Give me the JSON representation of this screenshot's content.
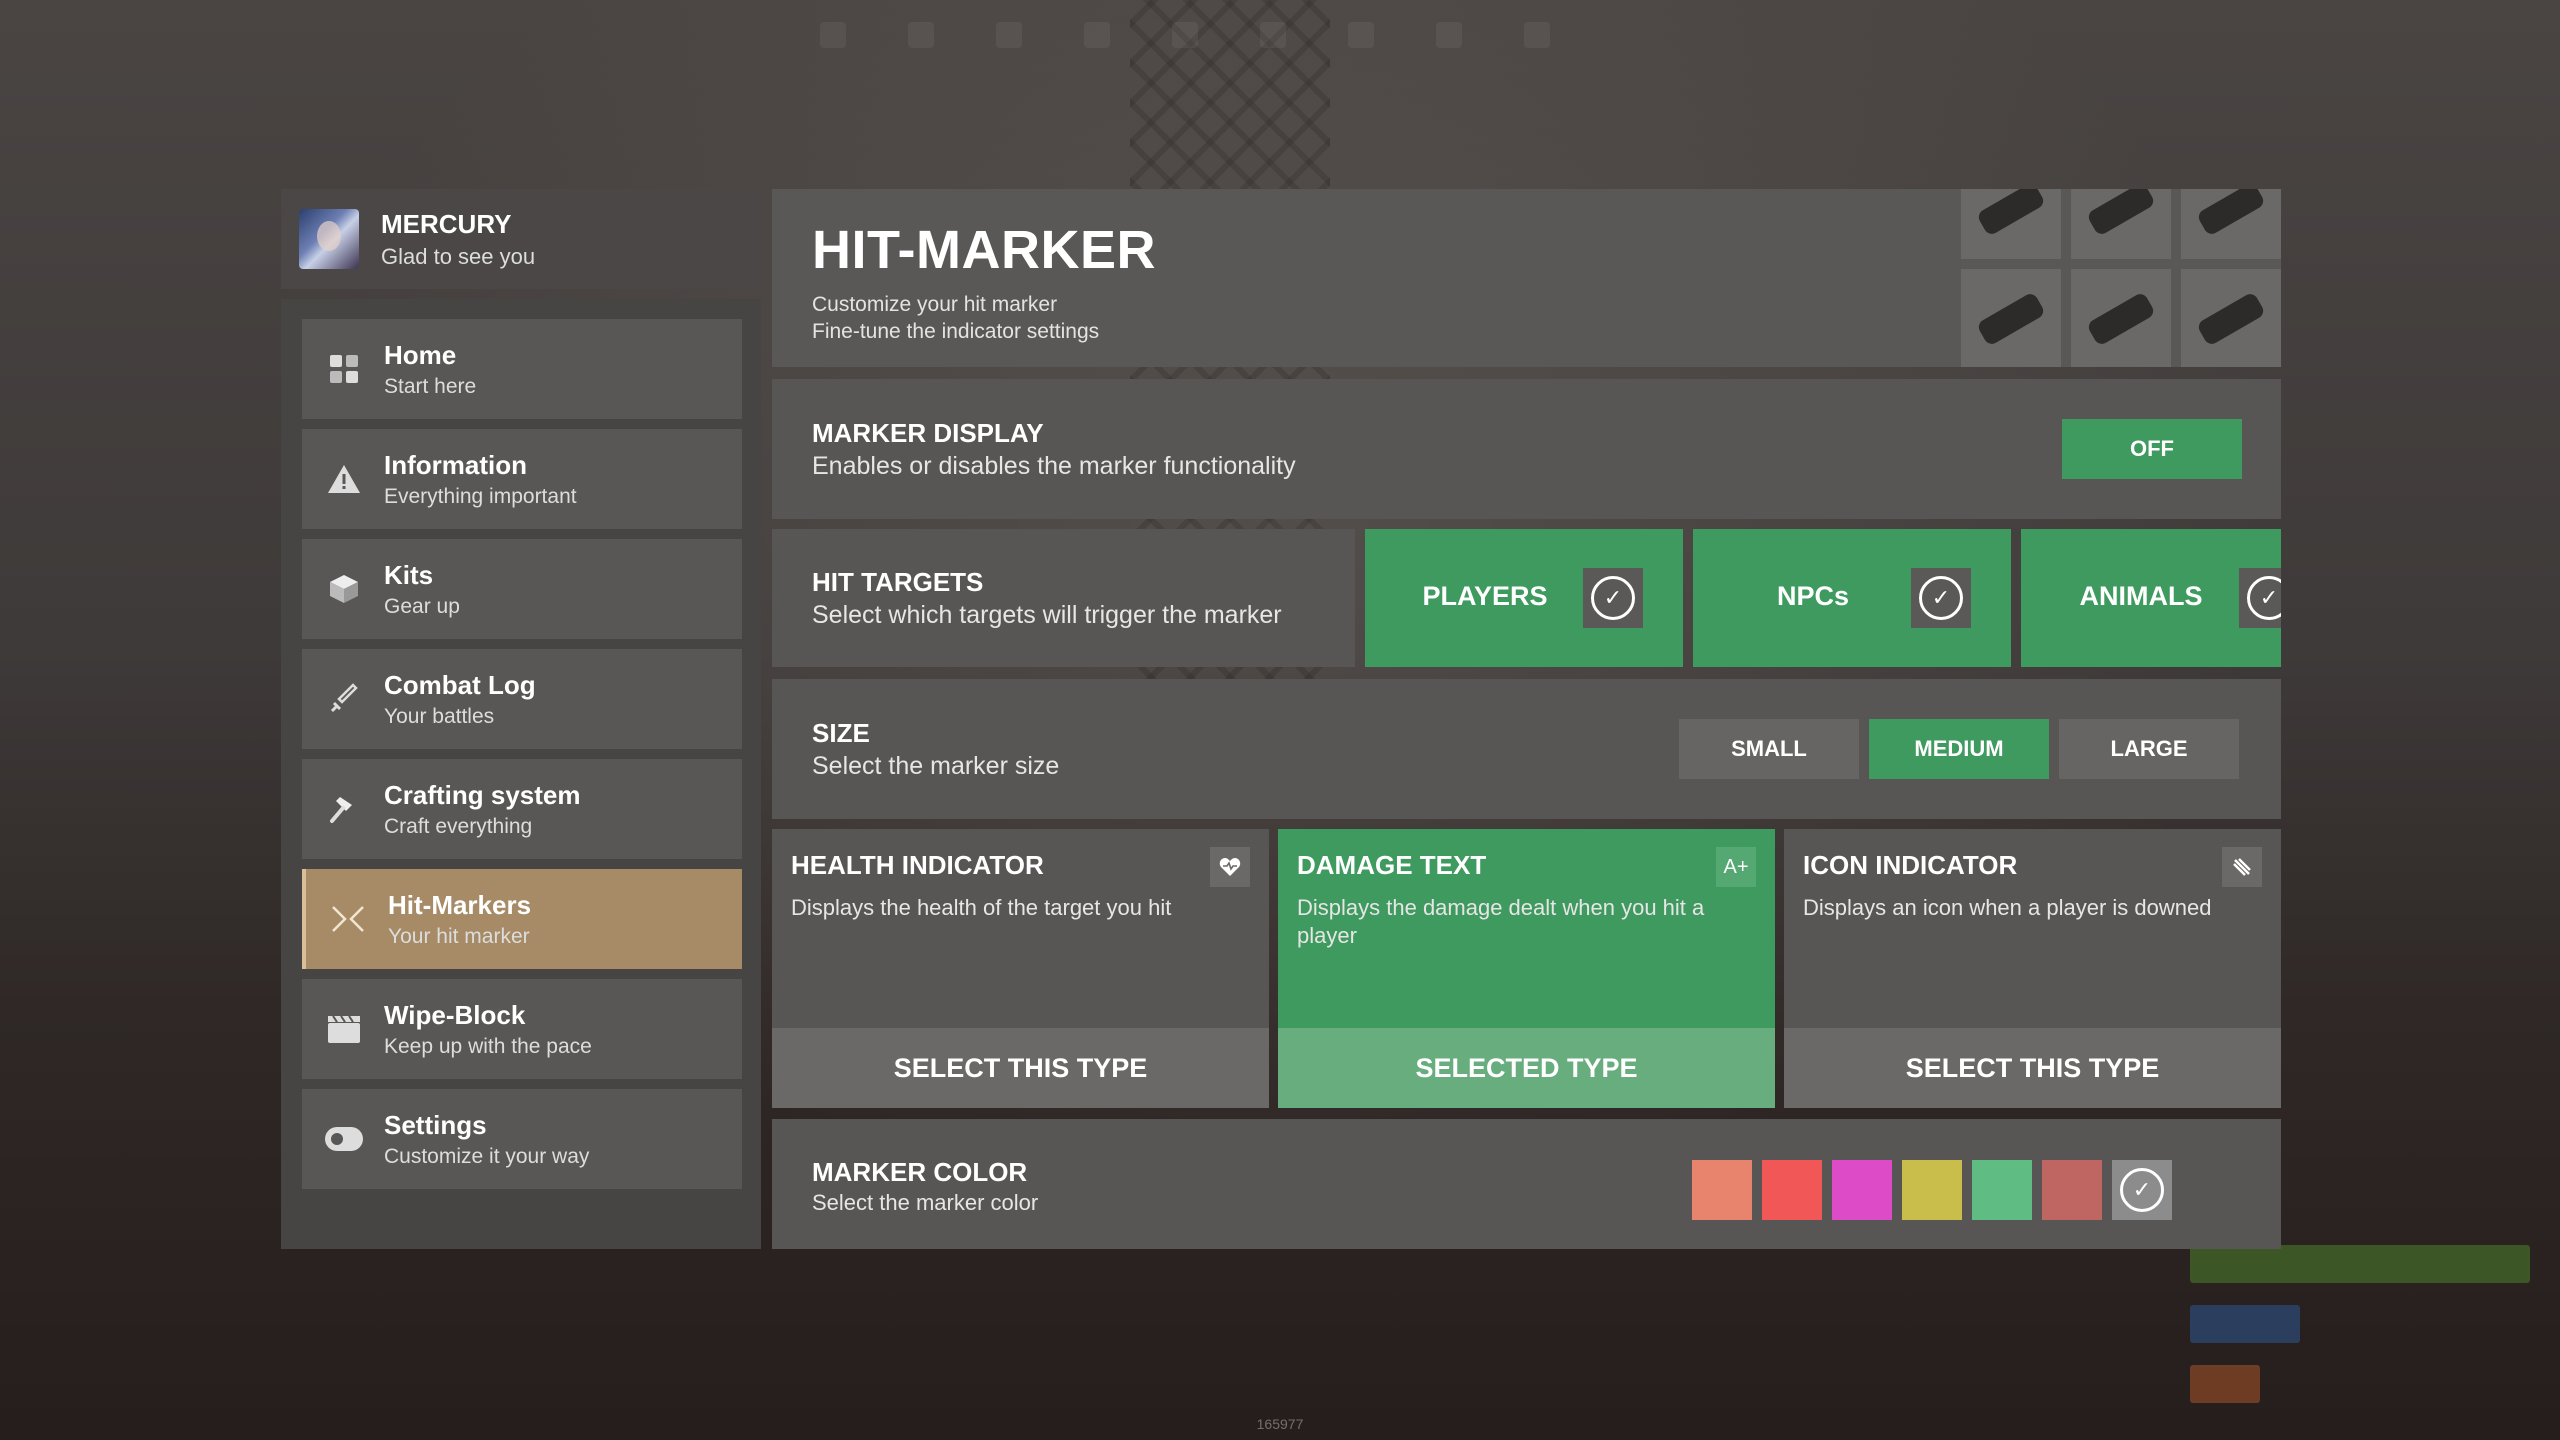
{
  "background": {
    "build_id": "165977"
  },
  "profile": {
    "name": "MERCURY",
    "greeting": "Glad to see you"
  },
  "sidebar": {
    "items": [
      {
        "label": "Home",
        "sub": "Start here",
        "icon": "grid-icon"
      },
      {
        "label": "Information",
        "sub": "Everything important",
        "icon": "warning-icon"
      },
      {
        "label": "Kits",
        "sub": "Gear up",
        "icon": "box-icon"
      },
      {
        "label": "Combat Log",
        "sub": "Your battles",
        "icon": "sword-icon"
      },
      {
        "label": "Crafting system",
        "sub": "Craft everything",
        "icon": "hammer-icon"
      },
      {
        "label": "Hit-Markers",
        "sub": "Your hit marker",
        "icon": "crosshair-icon",
        "active": true
      },
      {
        "label": "Wipe-Block",
        "sub": "Keep up with the pace",
        "icon": "clapperboard-icon"
      },
      {
        "label": "Settings",
        "sub": "Customize it your way",
        "icon": "toggle-icon"
      }
    ]
  },
  "header": {
    "title": "HIT-MARKER",
    "subtitle_1": "Customize your hit marker",
    "subtitle_2": "Fine-tune the indicator settings"
  },
  "marker_display": {
    "title": "MARKER DISPLAY",
    "description": "Enables or disables the marker functionality",
    "toggle_label": "OFF"
  },
  "hit_targets": {
    "title": "HIT TARGETS",
    "description": "Select which targets will trigger the marker",
    "options": [
      {
        "label": "PLAYERS",
        "checked": true
      },
      {
        "label": "NPCs",
        "checked": true
      },
      {
        "label": "ANIMALS",
        "checked": true
      }
    ]
  },
  "size": {
    "title": "SIZE",
    "description": "Select the marker size",
    "options": [
      "SMALL",
      "MEDIUM",
      "LARGE"
    ],
    "selected": "MEDIUM"
  },
  "types": [
    {
      "title": "HEALTH INDICATOR",
      "description": "Displays the health of the target you hit",
      "icon": "heart-icon",
      "button": "SELECT THIS TYPE",
      "selected": false
    },
    {
      "title": "DAMAGE TEXT",
      "description": "Displays the damage dealt when you hit a player",
      "icon": "text-size-icon",
      "icon_text": "A+",
      "button": "SELECTED TYPE",
      "selected": true
    },
    {
      "title": "ICON INDICATOR",
      "description": "Displays an icon when a player is downed",
      "icon": "downed-icon",
      "button": "SELECT THIS TYPE",
      "selected": false
    }
  ],
  "marker_color": {
    "title": "MARKER COLOR",
    "description": "Select the marker color",
    "swatches": [
      "#e8836d",
      "#f25757",
      "#dd4bc6",
      "#c9bd4b",
      "#5fbd83",
      "#bf6663",
      "#8c8c8c"
    ],
    "selected_index": 6
  },
  "colors": {
    "accent_green": "#3e9a5e",
    "active_nav": "#a68b66"
  }
}
